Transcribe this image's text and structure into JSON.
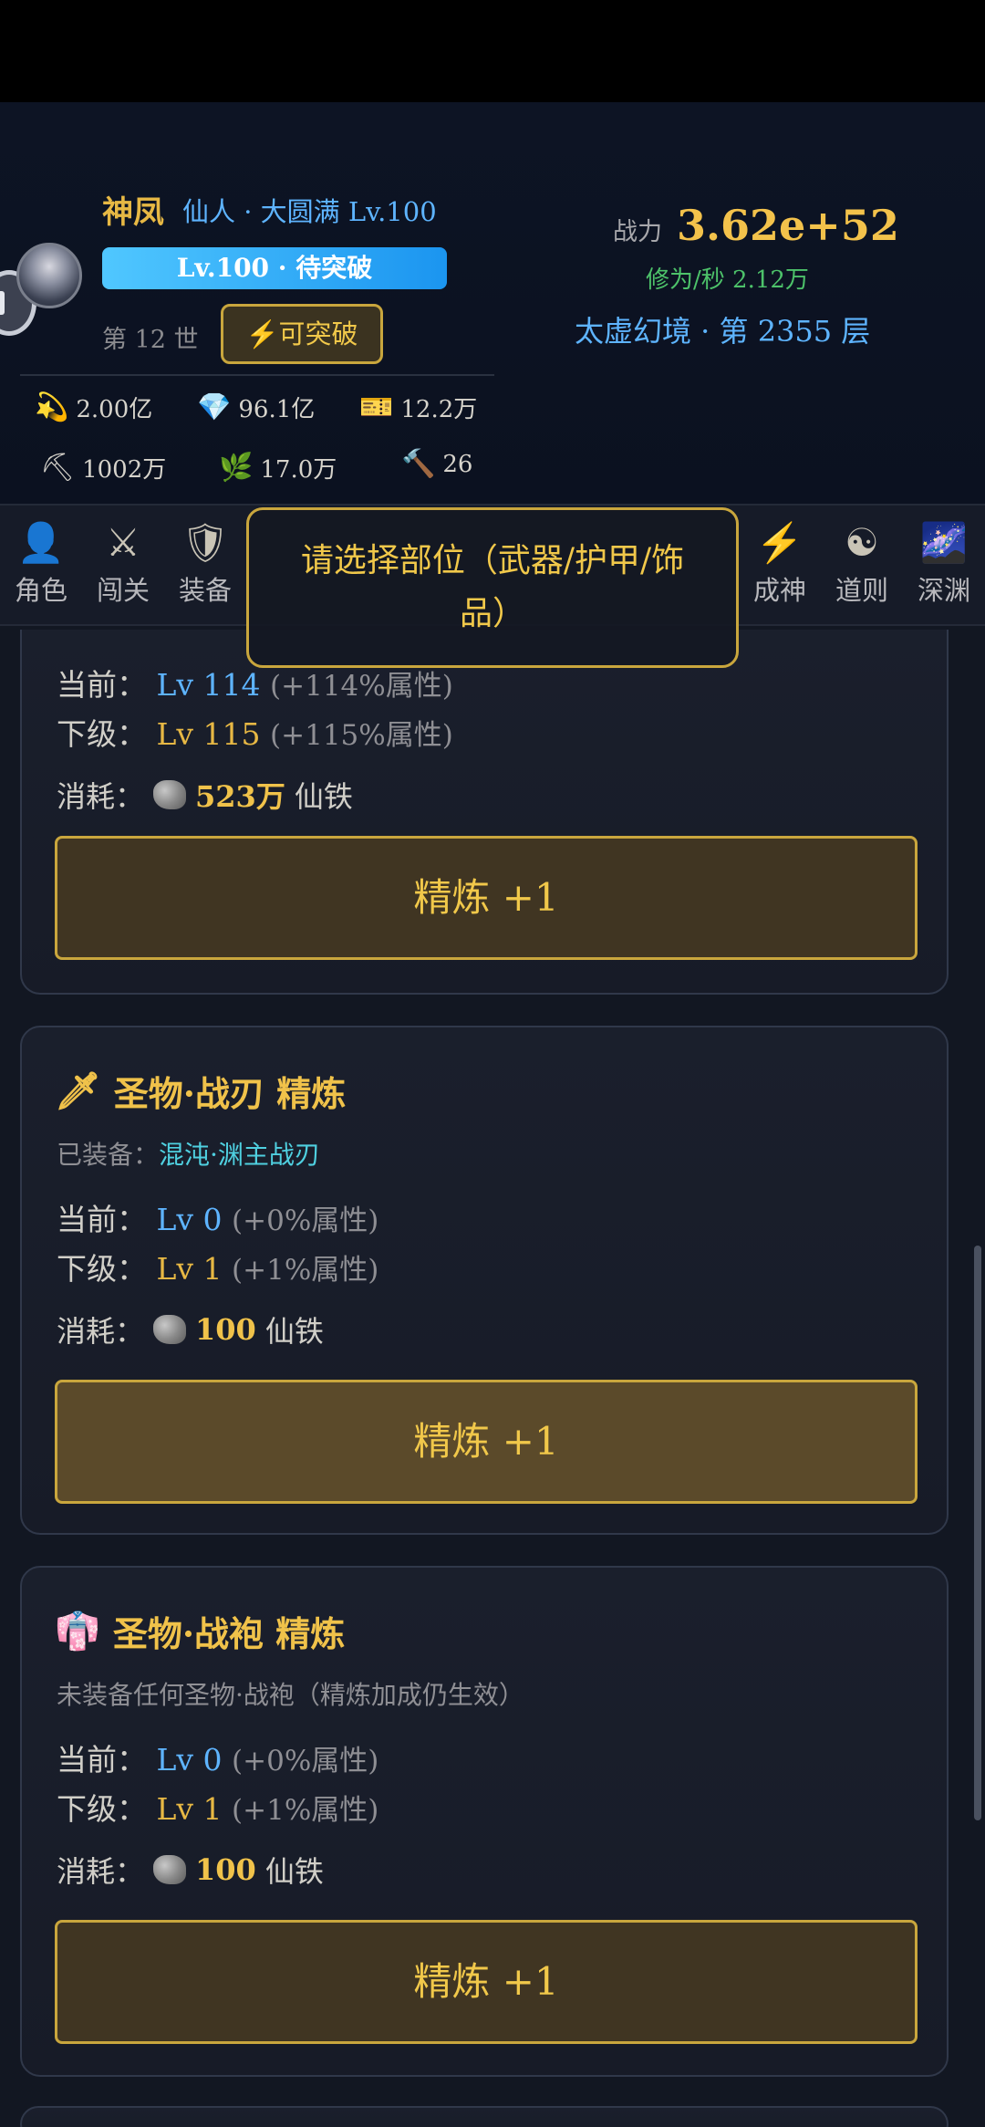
{
  "player": {
    "name": "神凤",
    "realm": "仙人 · 大圆满  Lv.100",
    "level_bar": "Lv.100 · 待突破",
    "generation": "第 12 世",
    "break_button": "可突破",
    "power_label": "战力",
    "power_value": "3.62e+52",
    "cultivation_rate": "修为/秒 2.12万",
    "stage": "太虚幻境 · 第 2355 层"
  },
  "resources": [
    {
      "icon": "coin-icon",
      "glyph": "💫",
      "value": "2.00亿"
    },
    {
      "icon": "diamond-icon",
      "glyph": "💎",
      "value": "96.1亿"
    },
    {
      "icon": "ticket-icon",
      "glyph": "🎫",
      "value": "12.2万"
    },
    {
      "icon": "pickaxe-icon",
      "glyph": "⛏",
      "value": "1002万"
    },
    {
      "icon": "herb-icon",
      "glyph": "🌿",
      "value": "17.0万"
    },
    {
      "icon": "hammer-icon",
      "glyph": "🔨",
      "value": "26"
    }
  ],
  "tabs": [
    {
      "label": "角色",
      "glyph": "👤"
    },
    {
      "label": "闯关",
      "glyph": "⚔"
    },
    {
      "label": "装备",
      "glyph": "🛡"
    },
    {
      "label": "成神",
      "glyph": "⚡"
    },
    {
      "label": "道则",
      "glyph": "☯"
    },
    {
      "label": "深渊",
      "glyph": "🌌"
    }
  ],
  "toast": "请选择部位（武器/护甲/饰品）",
  "cards": [
    {
      "current_label": "当前：",
      "current_lv": "Lv 114",
      "current_pct": "(+114%属性)",
      "next_label": "下级：",
      "next_lv": "Lv 115",
      "next_pct": "(+115%属性)",
      "cost_label": "消耗：",
      "cost_amount": "523万",
      "cost_unit": "仙铁",
      "button": "精炼 +1"
    },
    {
      "title": "圣物·战刃 精炼",
      "equip_label": "已装备：",
      "equip_name": "混沌·渊主战刃",
      "current_label": "当前：",
      "current_lv": "Lv 0",
      "current_pct": "(+0%属性)",
      "next_label": "下级：",
      "next_lv": "Lv 1",
      "next_pct": "(+1%属性)",
      "cost_label": "消耗：",
      "cost_amount": "100",
      "cost_unit": "仙铁",
      "button": "精炼 +1"
    },
    {
      "title": "圣物·战袍 精炼",
      "equip_note": "未装备任何圣物·战袍（精炼加成仍生效）",
      "current_label": "当前：",
      "current_lv": "Lv 0",
      "current_pct": "(+0%属性)",
      "next_label": "下级：",
      "next_lv": "Lv 1",
      "next_pct": "(+1%属性)",
      "cost_label": "消耗：",
      "cost_amount": "100",
      "cost_unit": "仙铁",
      "button": "精炼 +1"
    }
  ]
}
